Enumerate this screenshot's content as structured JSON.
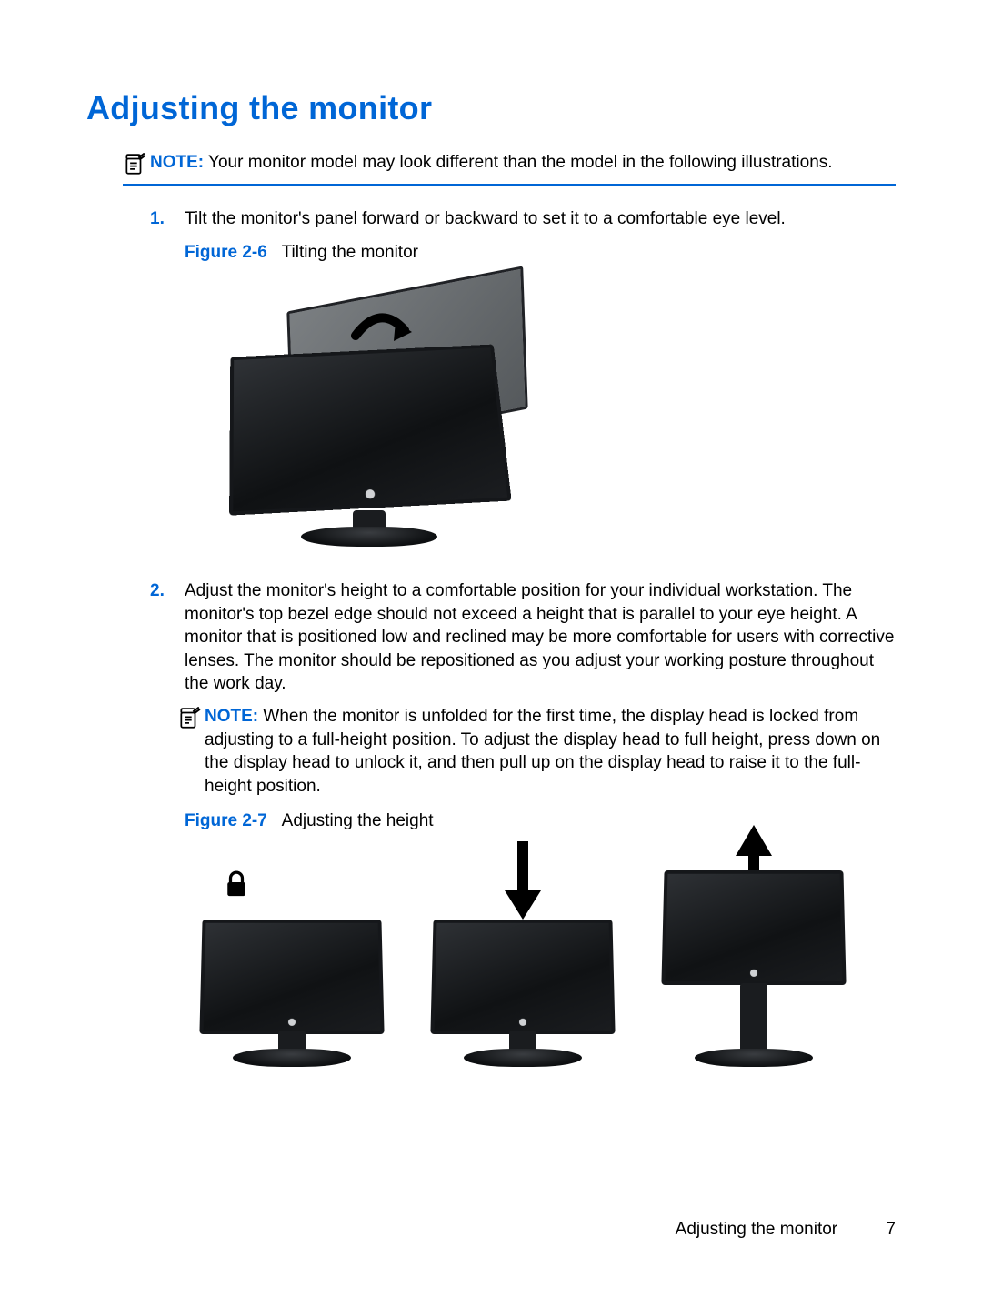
{
  "title": "Adjusting the monitor",
  "notes": {
    "top": {
      "label": "NOTE:",
      "text": "Your monitor model may look different than the model in the following illustrations."
    },
    "step2": {
      "label": "NOTE:",
      "text": "When the monitor is unfolded for the first time, the display head is locked from adjusting to a full-height position. To adjust the display head to full height, press down on the display head to unlock it, and then pull up on the display head to raise it to the full-height position."
    }
  },
  "steps": [
    {
      "number": "1.",
      "text": "Tilt the monitor's panel forward or backward to set it to a comfortable eye level.",
      "figure": {
        "label": "Figure 2-6",
        "caption": "Tilting the monitor"
      }
    },
    {
      "number": "2.",
      "text": "Adjust the monitor's height to a comfortable position for your individual workstation. The monitor's top bezel edge should not exceed a height that is parallel to your eye height. A monitor that is positioned low and reclined may be more comfortable for users with corrective lenses. The monitor should be repositioned as you adjust your working posture throughout the work day.",
      "figure": {
        "label": "Figure 2-7",
        "caption": "Adjusting the height"
      }
    }
  ],
  "footer": {
    "section": "Adjusting the monitor",
    "page": "7"
  }
}
